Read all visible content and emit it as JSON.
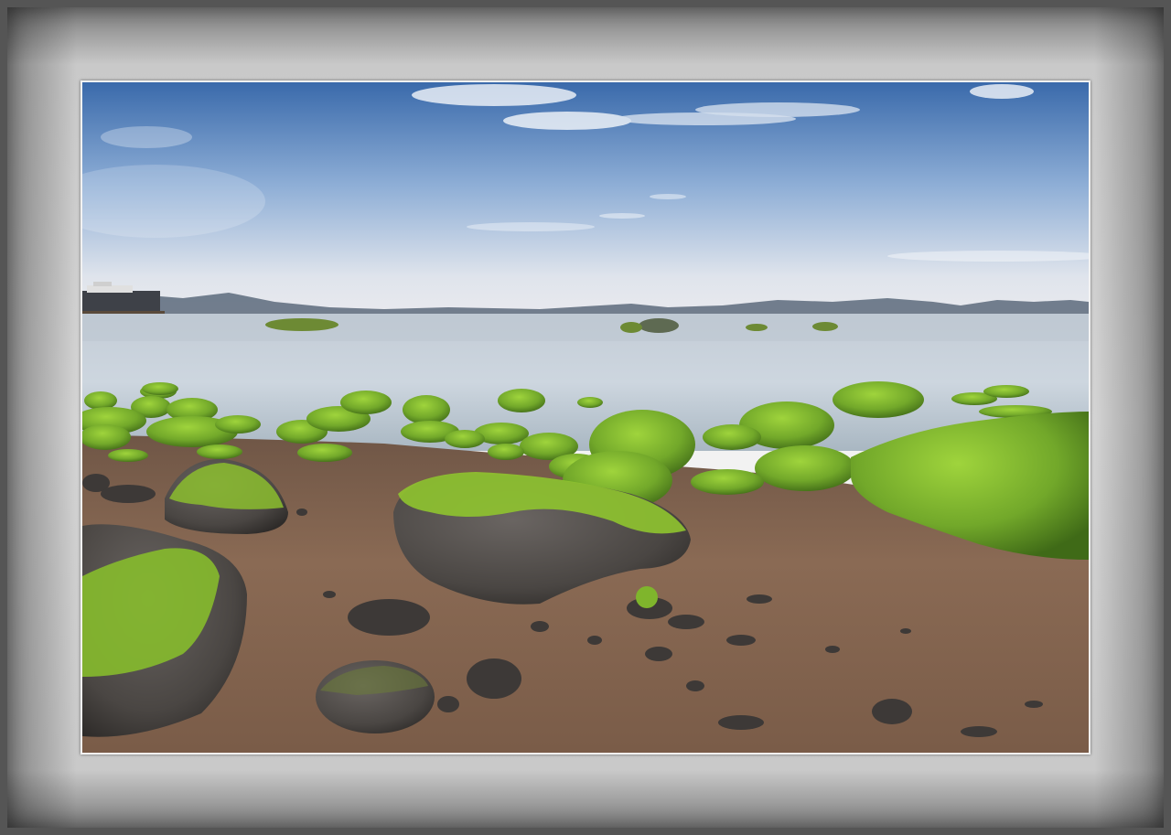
{
  "scene": {
    "subject": "coastal-landscape",
    "elements": [
      "sky",
      "clouds",
      "distant-mountains",
      "calm-sea",
      "moss-covered-rocks",
      "sandy-pebble-beach",
      "pier-building"
    ],
    "colors": {
      "sky_top": "#3d6fb0",
      "sky_horizon": "#e6e9ee",
      "water": "#c9d3dc",
      "moss": "#7cb52e",
      "moss_dark": "#4e7d1c",
      "sand": "#8a6a52",
      "rock": "#4a4744",
      "mat": "#d0d0d0",
      "frame": "#555555"
    }
  }
}
